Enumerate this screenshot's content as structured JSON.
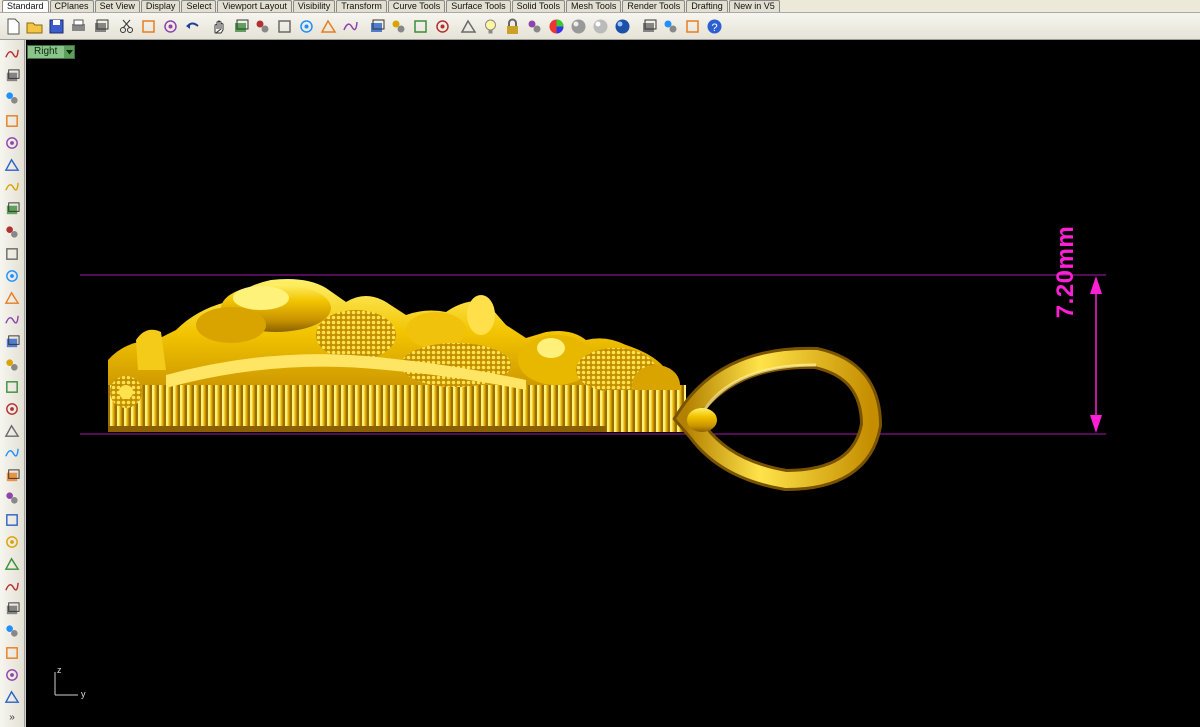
{
  "tabs": [
    {
      "label": "Standard",
      "active": true
    },
    {
      "label": "CPlanes"
    },
    {
      "label": "Set View"
    },
    {
      "label": "Display"
    },
    {
      "label": "Select"
    },
    {
      "label": "Viewport Layout"
    },
    {
      "label": "Visibility"
    },
    {
      "label": "Transform"
    },
    {
      "label": "Curve Tools"
    },
    {
      "label": "Surface Tools"
    },
    {
      "label": "Solid Tools"
    },
    {
      "label": "Mesh Tools"
    },
    {
      "label": "Render Tools"
    },
    {
      "label": "Drafting"
    },
    {
      "label": "New in V5"
    }
  ],
  "toolbar_icons": [
    "new-file",
    "open-file",
    "save",
    "print",
    "import",
    "cut",
    "copy",
    "paste",
    "undo",
    "pan",
    "rotate-view",
    "zoom-dynamic",
    "zoom-window",
    "zoom-extents",
    "zoom-selected",
    "undo-view",
    "four-viewports",
    "car-object",
    "move",
    "rotate-camera",
    "hide",
    "light-bulb",
    "lock",
    "layer",
    "color-wheel",
    "shade-sphere",
    "render-sphere",
    "blue-sphere",
    "paint-bucket",
    "options-gear",
    "grid-snap",
    "help"
  ],
  "left_icons": [
    "select-arrow",
    "point",
    "polyline",
    "curve",
    "circle",
    "arc",
    "ellipse",
    "polygon-curve",
    "rectangle",
    "circle-tool",
    "arc-tool",
    "free-curve",
    "nurbs-surface",
    "extrude",
    "box-solid",
    "spheres",
    "cylinder",
    "loft",
    "mesh-tools",
    "explode",
    "split",
    "trim",
    "boolean",
    "fillet",
    "blend",
    "text",
    "dimension",
    "group",
    "properties",
    "box-solid-2"
  ],
  "viewport": {
    "name": "Right",
    "dimension_label": "7.20mm",
    "axis_vertical_label": "z",
    "axis_horizontal_label": "y"
  },
  "colors": {
    "viewport_background": "#000000",
    "dimension": "#ff1fd4",
    "guide_lines": "#a81aa8",
    "model_gold": "#e6b800"
  }
}
